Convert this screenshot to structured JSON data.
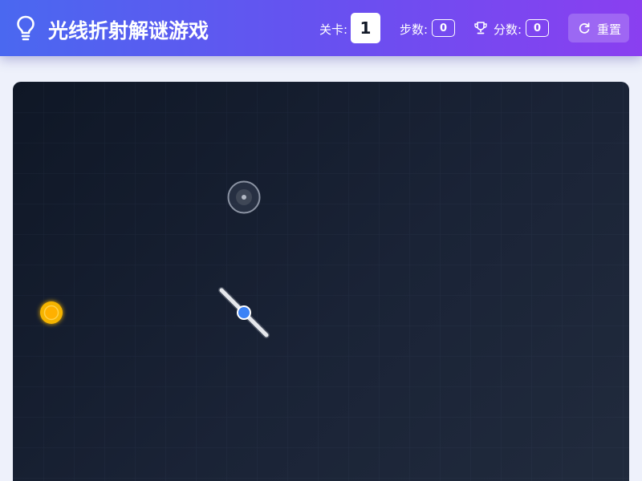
{
  "header": {
    "title": "光线折射解谜游戏",
    "level_label": "关卡:",
    "level_value": "1",
    "steps_label": "步数:",
    "steps_value": "0",
    "score_label": "分数:",
    "score_value": "0",
    "reset_label": "重置",
    "logo_icon": "lightbulb-icon",
    "score_icon": "trophy-icon",
    "reset_icon": "refresh-icon"
  },
  "game": {
    "light_source": {
      "color": "#f5b400"
    },
    "beam_color": "#ffc21a",
    "mirror": {
      "color": "#e5e7eb",
      "pivot_color": "#3b82f6"
    },
    "target": {
      "color": "#9ca3af"
    }
  }
}
